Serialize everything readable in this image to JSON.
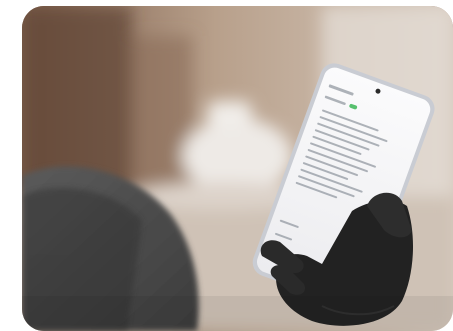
{
  "photo": {
    "subject": "phone-with-settings-screen",
    "colors": {
      "wall_dark": "#6f5343",
      "wall_mid": "#a88b73",
      "wall_light": "#d9cdc2",
      "table_white": "#e9e3dd",
      "sleeve": "#4c4c4c",
      "glove": "#262626",
      "phone_frame": "#cfd2d8",
      "screen": "#f4f4f6",
      "accent_toggle": "#2fb24c"
    }
  }
}
